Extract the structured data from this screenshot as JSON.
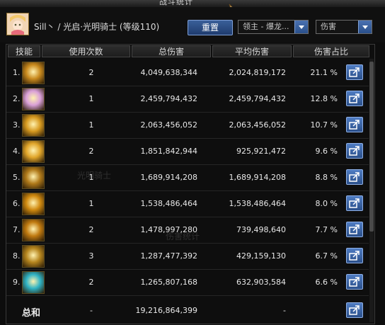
{
  "window": {
    "title": "战斗统计"
  },
  "header": {
    "character": "Sill丶 / 光启·光明骑士 (等级110)",
    "reset_label": "重置",
    "target_select": "领主 - 爆龙...",
    "metric_select": "伤害"
  },
  "table": {
    "columns": [
      "技能",
      "使用次数",
      "总伤害",
      "平均伤害",
      "伤害占比"
    ],
    "rows": [
      {
        "rank": "1.",
        "count": "2",
        "total": "4,049,638,344",
        "avg": "2,024,819,172",
        "pct": "21.1 %",
        "icon_color": "#c98a1e"
      },
      {
        "rank": "2.",
        "count": "1",
        "total": "2,459,794,432",
        "avg": "2,459,794,432",
        "pct": "12.8 %",
        "icon_color": "#d9a0d8"
      },
      {
        "rank": "3.",
        "count": "1",
        "total": "2,063,456,052",
        "avg": "2,063,456,052",
        "pct": "10.7 %",
        "icon_color": "#d79a20"
      },
      {
        "rank": "4.",
        "count": "2",
        "total": "1,851,842,944",
        "avg": "925,921,472",
        "pct": "9.6 %",
        "icon_color": "#e0a52a"
      },
      {
        "rank": "5.",
        "count": "1",
        "total": "1,689,914,208",
        "avg": "1,689,914,208",
        "pct": "8.8 %",
        "icon_color": "#b07a1a"
      },
      {
        "rank": "6.",
        "count": "1",
        "total": "1,538,486,464",
        "avg": "1,538,486,464",
        "pct": "8.0 %",
        "icon_color": "#d08a10"
      },
      {
        "rank": "7.",
        "count": "2",
        "total": "1,478,997,280",
        "avg": "739,498,640",
        "pct": "7.7 %",
        "icon_color": "#c07a10"
      },
      {
        "rank": "8.",
        "count": "3",
        "total": "1,287,477,392",
        "avg": "429,159,130",
        "pct": "6.7 %",
        "icon_color": "#b5851e"
      },
      {
        "rank": "9.",
        "count": "2",
        "total": "1,265,807,168",
        "avg": "632,903,584",
        "pct": "6.6 %",
        "icon_color": "#2fb3c4"
      }
    ],
    "total": {
      "label": "总和",
      "count": "-",
      "total": "19,216,864,399",
      "avg": "-"
    }
  }
}
